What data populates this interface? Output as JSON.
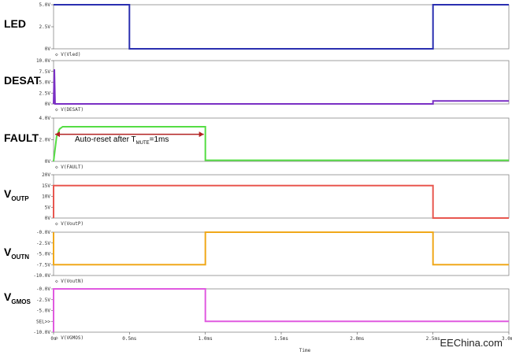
{
  "chart_data": {
    "type": "line",
    "xlabel": "Time",
    "xlim": [
      0,
      3.0
    ],
    "x_ticks": [
      "0s",
      "0.5ms",
      "1.0ms",
      "1.5ms",
      "2.0ms",
      "2.5ms",
      "3.0ms"
    ],
    "panels": [
      {
        "label_main": "LED",
        "label_sub": "",
        "trace_name": "V(Vled)",
        "ylim": [
          0,
          5
        ],
        "y_ticks": [
          [
            "5.0V",
            5
          ],
          [
            "2.5V",
            2.5
          ],
          [
            "0V",
            0
          ]
        ],
        "color": "#2a2fb0",
        "x": [
          0,
          0.5,
          0.5,
          2.5,
          2.5,
          3.0
        ],
        "y": [
          5,
          5,
          0,
          0,
          5,
          5
        ]
      },
      {
        "label_main": "DESAT",
        "label_sub": "",
        "trace_name": "V(DESAT)",
        "ylim": [
          0,
          10
        ],
        "y_ticks": [
          [
            "10.0V",
            10
          ],
          [
            "7.5V",
            7.5
          ],
          [
            "5.0V",
            5
          ],
          [
            "2.5V",
            2.5
          ],
          [
            "0V",
            0
          ]
        ],
        "color": "#7a2fc4",
        "x": [
          0,
          0.005,
          0.01,
          2.5,
          2.5,
          3.0
        ],
        "y": [
          0,
          8,
          0,
          0,
          0.7,
          0.7
        ]
      },
      {
        "label_main": "FAULT",
        "label_sub": "",
        "trace_name": "V(FAULT)",
        "ylim": [
          0,
          4
        ],
        "y_ticks": [
          [
            "4.0V",
            4
          ],
          [
            "2.0V",
            2
          ],
          [
            "0V",
            0
          ]
        ],
        "color": "#55dd44",
        "x": [
          0,
          0.02,
          0.04,
          0.06,
          0.1,
          0.15,
          1.0,
          1.0,
          3.0
        ],
        "y": [
          0,
          2.3,
          3.0,
          3.2,
          3.2,
          3.2,
          3.2,
          0.1,
          0.1
        ]
      },
      {
        "label_main": "V",
        "label_sub": "OUTP",
        "trace_name": "V(VoutP)",
        "ylim": [
          0,
          20
        ],
        "y_ticks": [
          [
            "20V",
            20
          ],
          [
            "15V",
            15
          ],
          [
            "10V",
            10
          ],
          [
            "5V",
            5
          ],
          [
            "0V",
            0
          ]
        ],
        "color": "#e8574f",
        "x": [
          0,
          0,
          2.5,
          2.5,
          3.0
        ],
        "y": [
          0,
          15,
          15,
          0,
          0
        ]
      },
      {
        "label_main": "V",
        "label_sub": "OUTN",
        "trace_name": "V(VoutN)",
        "ylim": [
          -10,
          0
        ],
        "y_ticks": [
          [
            "-0.0V",
            0
          ],
          [
            "-2.5V",
            -2.5
          ],
          [
            "-5.0V",
            -5
          ],
          [
            "-7.5V",
            -7.5
          ],
          [
            "-10.0V",
            -10
          ]
        ],
        "color": "#f0a81a",
        "x": [
          0,
          0,
          1.0,
          1.0,
          2.5,
          2.5,
          3.0
        ],
        "y": [
          0,
          -7.5,
          -7.5,
          0,
          0,
          -7.5,
          -7.5
        ]
      },
      {
        "label_main": "V",
        "label_sub": "GMOS",
        "trace_name": "V(VGMOS)",
        "ylim": [
          -10,
          0
        ],
        "y_ticks": [
          [
            "-0.0V",
            0
          ],
          [
            "-2.5V",
            -2.5
          ],
          [
            "-5.0V",
            -5
          ],
          [
            "SEL>>",
            -7.5
          ],
          [
            "-10.0V",
            -10
          ]
        ],
        "color": "#e05ae0",
        "x": [
          0,
          0,
          1.0,
          1.0,
          3.0
        ],
        "y": [
          -10,
          0,
          0,
          -7.5,
          -7.5
        ]
      }
    ],
    "annotation": {
      "text_pre": "Auto-reset after T",
      "text_sub": "MUTE",
      "text_post": "=1ms",
      "arrow_color": "#b22222",
      "x_start": 0,
      "x_end": 1.0,
      "y": 2.5
    }
  },
  "watermark": "EEChina.com"
}
